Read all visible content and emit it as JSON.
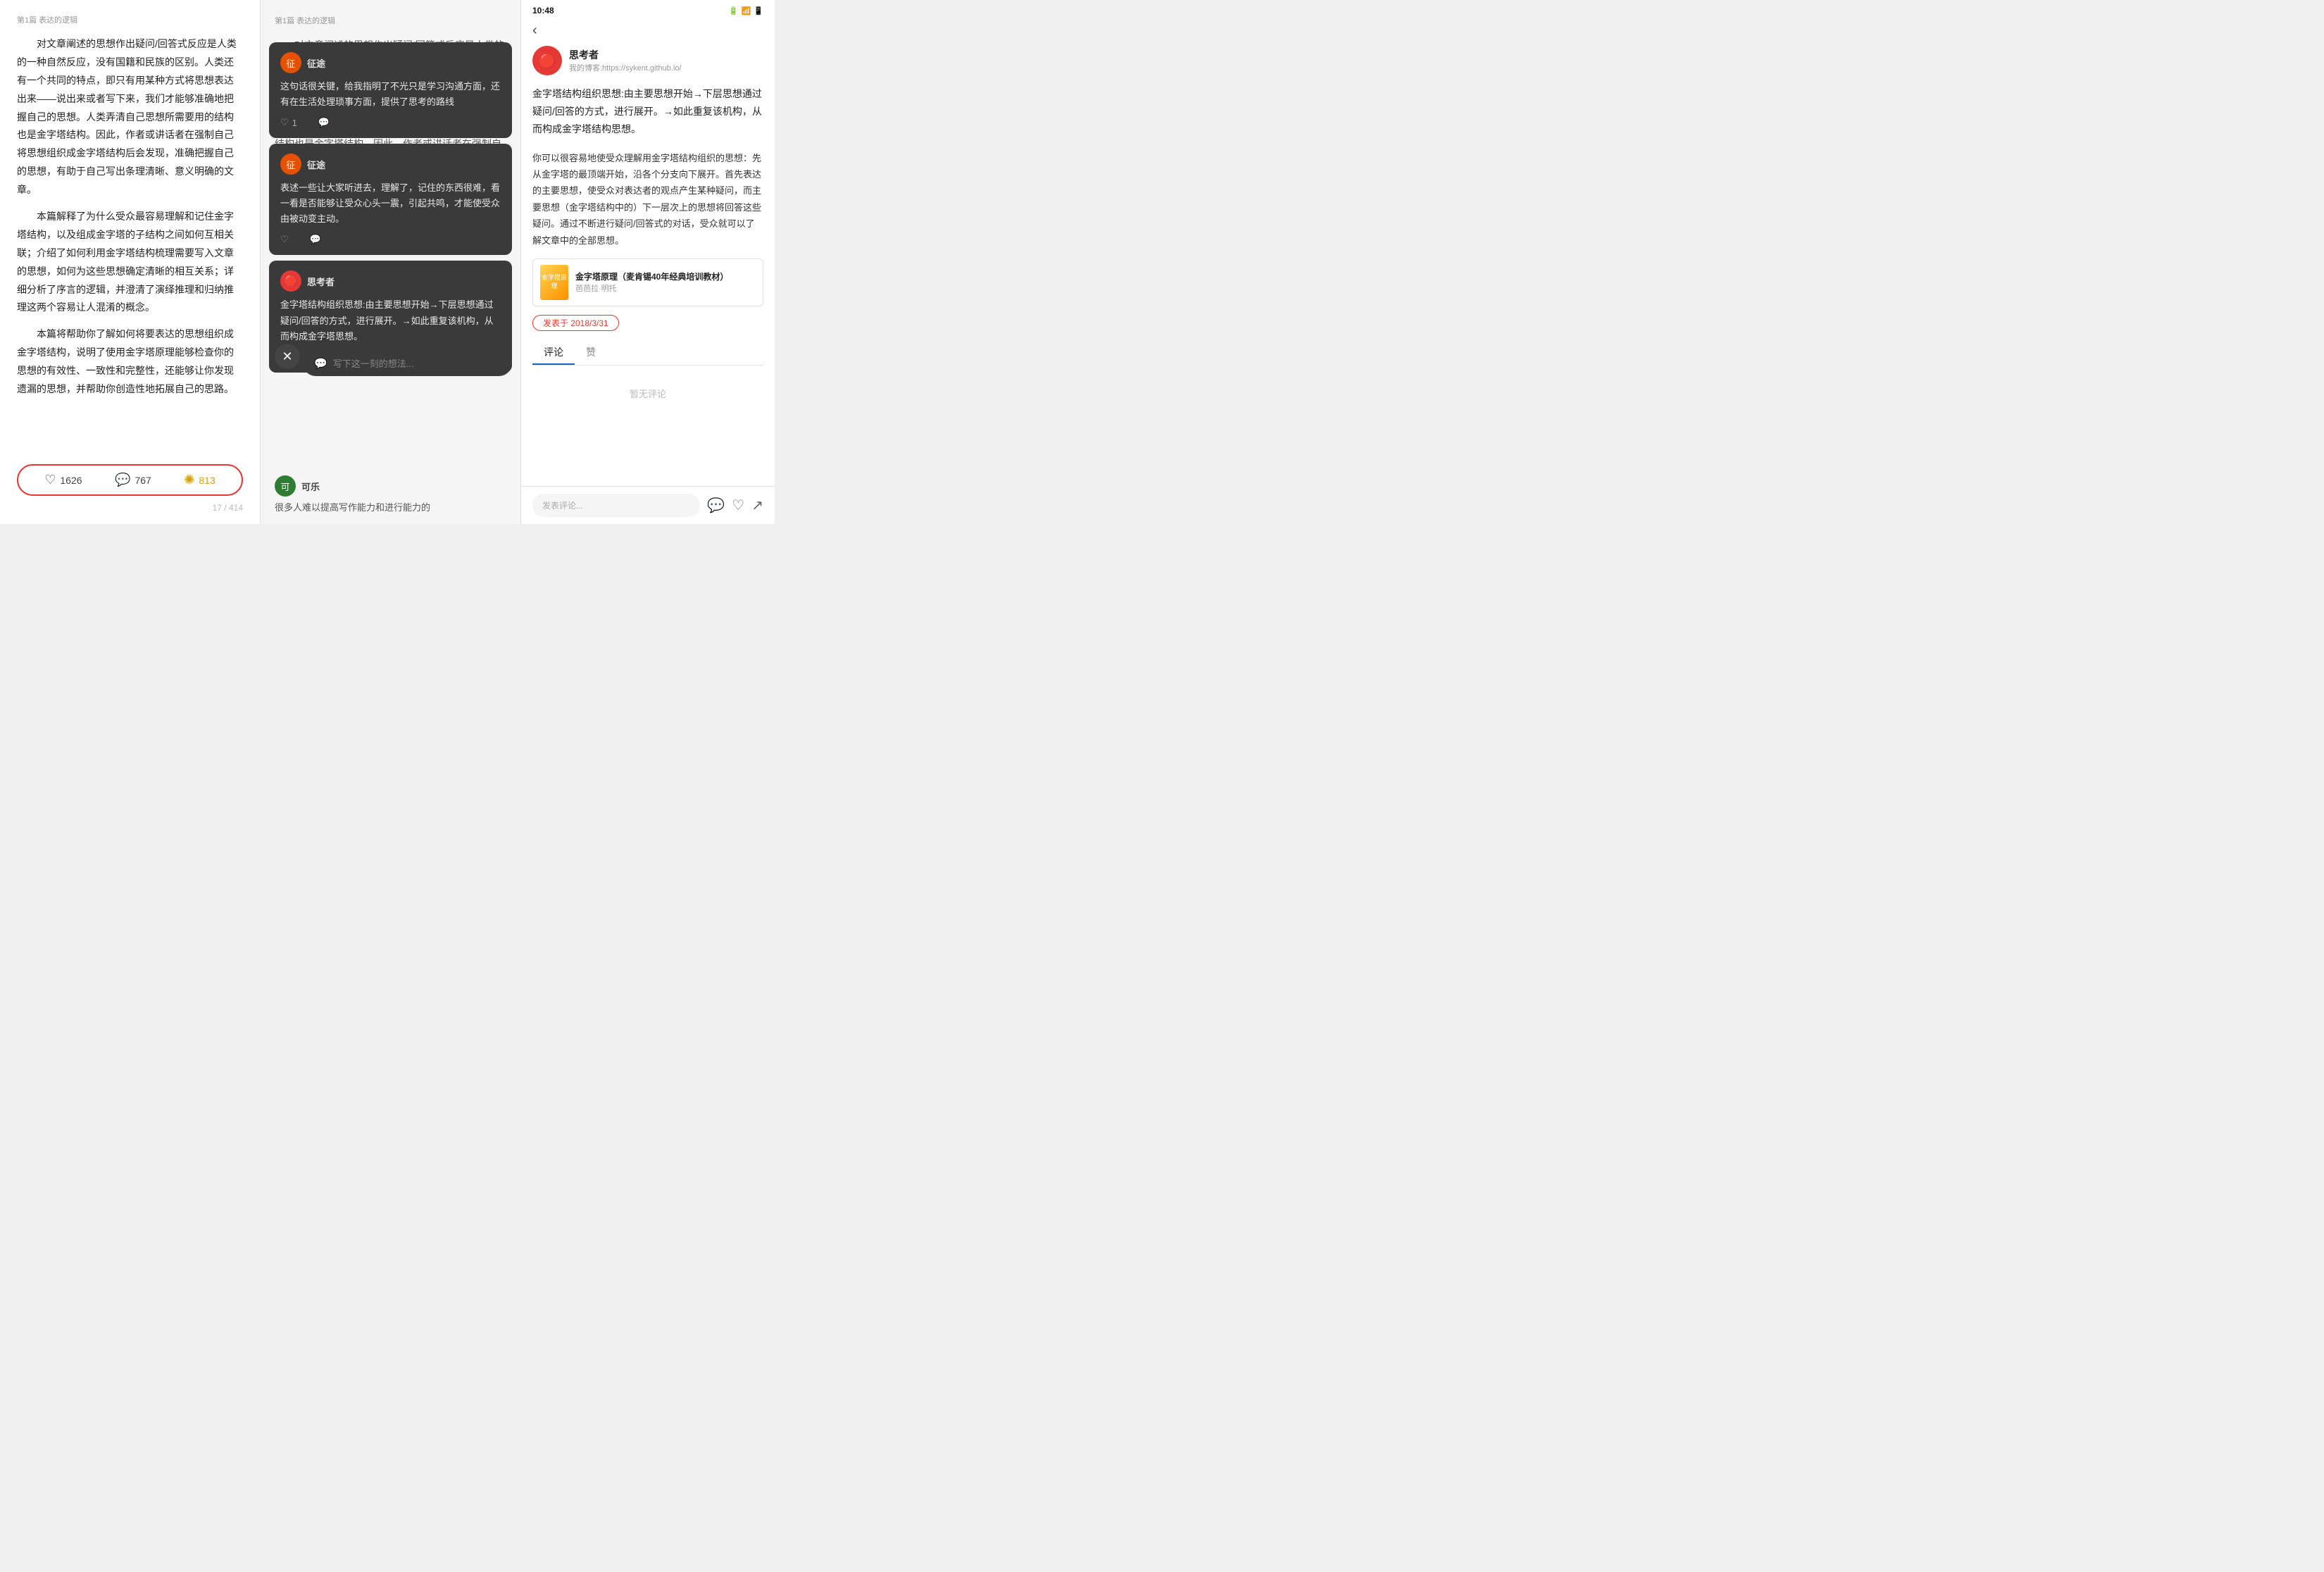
{
  "panel1": {
    "header": "第1篇 表达的逻辑",
    "paragraphs": [
      "对文章阐述的思想作出疑问/回答式反应是人类的一种自然反应，没有国籍和民族的区别。人类还有一个共同的特点，即只有用某种方式将思想表达出来——说出来或者写下来，我们才能够准确地把握自己的思想。人类弄清自己思想所需要用的结构也是金字塔结构。因此，作者或讲话者在强制自己将思想组织成金字塔结构后会发现，准确把握自己的思想，有助于自己写出条理清晰、意义明确的文章。",
      "本篇解释了为什么受众最容易理解和记住金字塔结构，以及组成金字塔的子结构之间如何互相关联；介绍了如何利用金字塔结构梳理需要写入文章的思想，如何为这些思想确定清晰的相互关系；详细分析了序言的逻辑，并澄清了演绎推理和归纳推理这两个容易让人混淆的概念。",
      "本篇将帮助你了解如何将要表达的思想组织成金字塔结构，说明了使用金字塔原理能够检查你的思想的有效性、一致性和完整性，还能够让你发现遗漏的思想，并帮助你创造性地拓展自己的思路。"
    ],
    "action_like": "1626",
    "action_comment": "767",
    "action_share": "813",
    "page_num": "17 / 414"
  },
  "panel2": {
    "header": "第1篇 表达的逻辑",
    "bg_paragraphs": [
      "对文章阐述的思想作出疑问/回答式反应是人类的一种自然反应，没有国籍和民族的区别。人类还有一个共同的特点，即只有用某种方式将思想表达出来——说出来或者写下来，我们才能够准确地",
      "把握自身的思想。人类弄清自己思想所需要用的结构也是金字塔结构。因此，作者或讲话者在强制自"
    ],
    "comments": [
      {
        "username": "征途",
        "avatar_color": "orange",
        "avatar_letter": "征",
        "text": "这句话很关键，给我指明了不光只是学习沟通方面，还有在生活处理琐事方面，提供了思考的路线",
        "likes": "1",
        "has_reply": true
      },
      {
        "username": "征途",
        "avatar_color": "orange",
        "avatar_letter": "征",
        "text": "表述一些让大家听进去，理解了，记住的东西很难，看一看是否能够让受众心头一震，引起共鸣，才能使受众由被动变主动。",
        "likes": "",
        "has_reply": true
      },
      {
        "username": "思考者",
        "avatar_color": "blue",
        "avatar_letter": "🔴",
        "text": "金字塔结构组织思想:由主要思想开始→下层思想通过疑问/回答的方式，进行展开。→如此重复该机构，从而构成金字塔思想。",
        "likes": "",
        "has_reply": true
      }
    ],
    "input_placeholder": "写下这一刻的想法...",
    "last_comment_username": "可乐",
    "last_comment_avatar": "green",
    "last_comment_letter": "可",
    "last_comment_text": "很多人难以提高写作能力和进行能力的"
  },
  "panel3": {
    "status_time": "10:48",
    "author_name": "思考者",
    "author_link": "我的博客:https://sykent.github.io/",
    "author_avatar_emoji": "🔴",
    "main_quote": "金字塔结构组织思想:由主要思想开始→下层思想通过疑问/回答的方式，进行展开。→如此重复该机构，从而构成金字塔结构思想。",
    "sub_quote": "你可以很容易地使受众理解用金字塔结构组织的思想：先从金字塔的最顶端开始，沿各个分支向下展开。首先表达的主要思想，使受众对表达者的观点产生某种疑问，而主要思想（金字塔结构中的）下一层次上的思想将回答这些疑问。通过不断进行疑问/回答式的对话，受众就可以了解文章中的全部思想。",
    "book_title": "金字塔原理（麦肯锡40年经典培训教材）",
    "book_sub": "芭芭拉·明托",
    "publish_date": "发表于 2018/3/31",
    "tab_comment": "评论",
    "tab_like": "赞",
    "no_comment": "暂无评论",
    "comment_placeholder": "发表评论..."
  }
}
